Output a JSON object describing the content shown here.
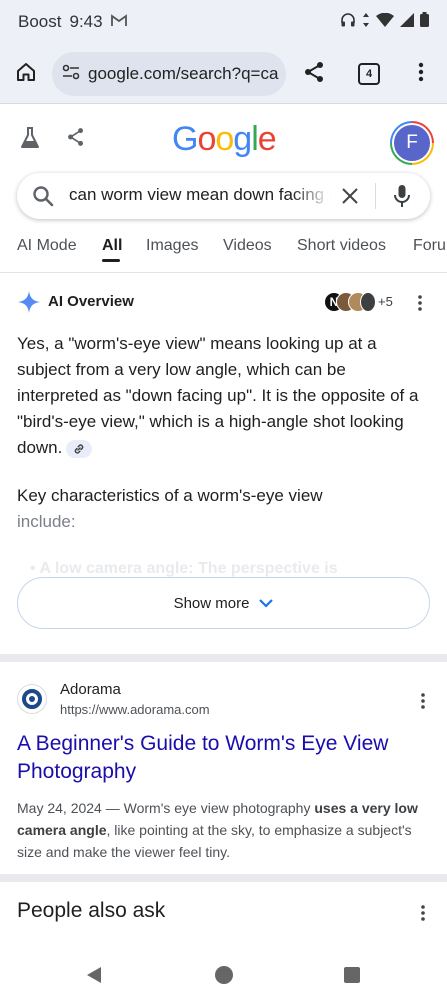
{
  "status_bar": {
    "carrier": "Boost",
    "time": "9:43"
  },
  "browser": {
    "url": "google.com/search?q=ca",
    "tab_count": "4"
  },
  "google": {
    "logo": "Google",
    "avatar_letter": "F"
  },
  "search": {
    "query": "can worm view mean down facing up"
  },
  "tabs": [
    {
      "label": "AI Mode"
    },
    {
      "label": "All"
    },
    {
      "label": "Images"
    },
    {
      "label": "Videos"
    },
    {
      "label": "Short videos"
    },
    {
      "label": "Forums"
    }
  ],
  "ai_overview": {
    "title": "AI Overview",
    "source_count": "+5",
    "body": "Yes, a \"worm's-eye view\" means looking up at a subject from a very low angle, which can be interpreted as \"down facing up\". It is the opposite of a \"bird's-eye view,\" which is a high-angle shot looking down.",
    "sub_heading_1": "Key characteristics of a worm's-eye view",
    "sub_heading_2": "include:",
    "bullet_faded": "A low camera angle: The perspective is",
    "show_more": "Show more"
  },
  "result": {
    "site_name": "Adorama",
    "site_url": "https://www.adorama.com",
    "title": "A Beginner's Guide to Worm's Eye View Photography",
    "date": "May 24, 2024",
    "snippet_1": " — Worm's eye view photography ",
    "snippet_bold_1": "uses a very low camera angle",
    "snippet_2": ", like pointing at the sky, to emphasize a subject's size and make the viewer feel tiny."
  },
  "people_also_ask": {
    "title": "People also ask"
  },
  "colors": {
    "link": "#1a0dab",
    "accent": "#4285f4",
    "chrome_bg": "#eef0f8"
  }
}
